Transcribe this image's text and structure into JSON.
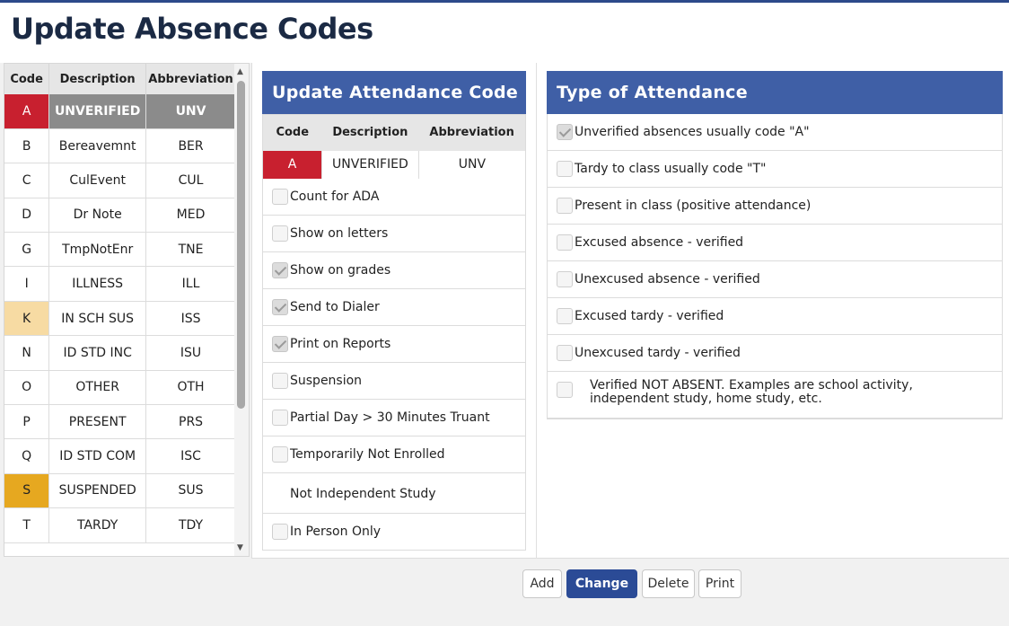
{
  "page": {
    "title": "Update Absence Codes"
  },
  "code_list": {
    "headers": [
      "Code",
      "Description",
      "Abbreviation"
    ],
    "rows": [
      {
        "code": "A",
        "description": "UNVERIFIED",
        "abbreviation": "UNV",
        "code_color": "#c8202f",
        "selected": true
      },
      {
        "code": "B",
        "description": "Bereavemnt",
        "abbreviation": "BER",
        "code_color": ""
      },
      {
        "code": "C",
        "description": "CulEvent",
        "abbreviation": "CUL",
        "code_color": ""
      },
      {
        "code": "D",
        "description": "Dr Note",
        "abbreviation": "MED",
        "code_color": ""
      },
      {
        "code": "G",
        "description": "TmpNotEnr",
        "abbreviation": "TNE",
        "code_color": ""
      },
      {
        "code": "I",
        "description": "ILLNESS",
        "abbreviation": "ILL",
        "code_color": ""
      },
      {
        "code": "K",
        "description": "IN SCH SUS",
        "abbreviation": "ISS",
        "code_color": "#f7dba3"
      },
      {
        "code": "N",
        "description": "ID STD INC",
        "abbreviation": "ISU",
        "code_color": ""
      },
      {
        "code": "O",
        "description": "OTHER",
        "abbreviation": "OTH",
        "code_color": ""
      },
      {
        "code": "P",
        "description": "PRESENT",
        "abbreviation": "PRS",
        "code_color": ""
      },
      {
        "code": "Q",
        "description": "ID STD COM",
        "abbreviation": "ISC",
        "code_color": ""
      },
      {
        "code": "S",
        "description": "SUSPENDED",
        "abbreviation": "SUS",
        "code_color": "#e6a820"
      },
      {
        "code": "T",
        "description": "TARDY",
        "abbreviation": "TDY",
        "code_color": ""
      }
    ]
  },
  "update_panel": {
    "title": "Update Attendance Code",
    "headers": [
      "Code",
      "Description",
      "Abbreviation"
    ],
    "current": {
      "code": "A",
      "description": "UNVERIFIED",
      "abbreviation": "UNV",
      "code_color": "#c8202f"
    },
    "options": [
      {
        "label": "Count for ADA",
        "checked": false,
        "has_checkbox": true
      },
      {
        "label": "Show on letters",
        "checked": false,
        "has_checkbox": true
      },
      {
        "label": "Show on grades",
        "checked": true,
        "has_checkbox": true
      },
      {
        "label": "Send to Dialer",
        "checked": true,
        "has_checkbox": true
      },
      {
        "label": "Print on Reports",
        "checked": true,
        "has_checkbox": true
      },
      {
        "label": "Suspension",
        "checked": false,
        "has_checkbox": true
      },
      {
        "label": "Partial Day > 30 Minutes Truant",
        "checked": false,
        "has_checkbox": true
      },
      {
        "label": "Temporarily Not Enrolled",
        "checked": false,
        "has_checkbox": true
      },
      {
        "label": "Not Independent Study",
        "checked": false,
        "has_checkbox": false
      },
      {
        "label": "In Person Only",
        "checked": false,
        "has_checkbox": true
      }
    ]
  },
  "type_panel": {
    "title": "Type of Attendance",
    "options": [
      {
        "label": "Unverified absences usually code \"A\"",
        "checked": true
      },
      {
        "label": "Tardy to class usually code \"T\"",
        "checked": false
      },
      {
        "label": "Present in class (positive attendance)",
        "checked": false
      },
      {
        "label": "Excused absence - verified",
        "checked": false
      },
      {
        "label": "Unexcused absence - verified",
        "checked": false
      },
      {
        "label": "Excused tardy - verified",
        "checked": false
      },
      {
        "label": "Unexcused tardy - verified",
        "checked": false
      },
      {
        "label": "Verified NOT ABSENT. Examples are school activity, independent study, home study, etc.",
        "checked": false
      }
    ]
  },
  "actions": {
    "add": "Add",
    "change": "Change",
    "delete": "Delete",
    "print": "Print"
  },
  "colors": {
    "accent": "#3f5fa6",
    "primary_button": "#2b4b96",
    "code_red": "#c8202f"
  }
}
